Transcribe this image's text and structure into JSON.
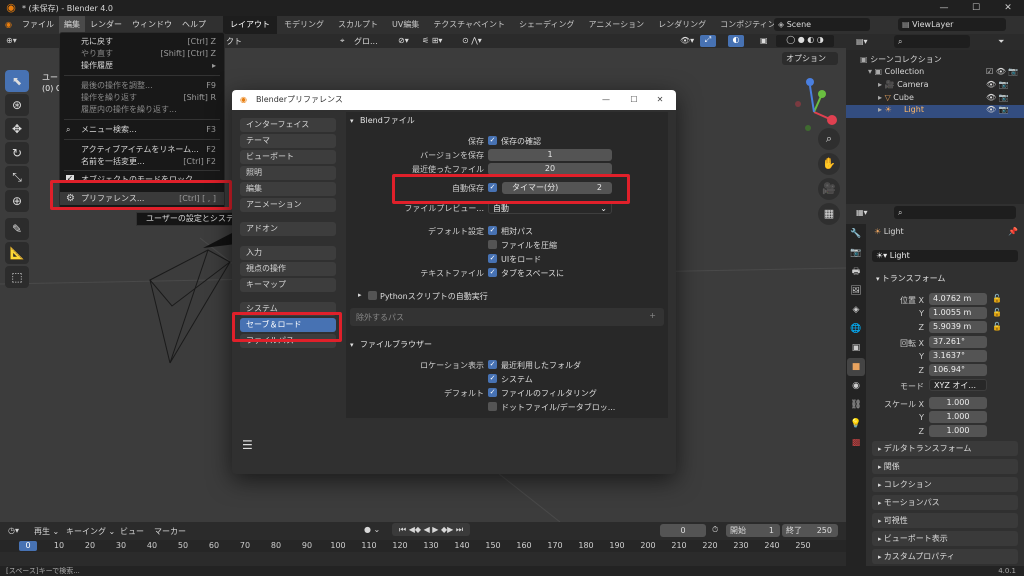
{
  "window": {
    "title": "* (未保存) - Blender 4.0",
    "controls": [
      "—",
      "☐",
      "✕"
    ]
  },
  "menubar": {
    "items": [
      "ファイル",
      "編集",
      "レンダー",
      "ウィンドウ",
      "ヘルプ"
    ],
    "workspaces": [
      "レイアウト",
      "モデリング",
      "スカルプト",
      "UV編集",
      "テクスチャペイント",
      "シェーディング",
      "アニメーション",
      "レンダリング",
      "コンポジティング"
    ],
    "scene": "Scene",
    "view_layer": "ViewLayer"
  },
  "viewport_header": {
    "mode_partial": "クト",
    "transform_orientation": "グロ...",
    "options": "オプション"
  },
  "viewport_text": {
    "line1": "ユー",
    "line2": "(0) C"
  },
  "edit_menu": {
    "items": [
      {
        "label": "元に戻す",
        "shortcut": "[Ctrl] Z",
        "dim": false
      },
      {
        "label": "やり直す",
        "shortcut": "[Shift] [Ctrl] Z",
        "dim": true
      },
      {
        "label": "操作履歴",
        "shortcut": "▸",
        "dim": false
      },
      {
        "label": "最後の操作を調整...",
        "shortcut": "F9",
        "dim": true
      },
      {
        "label": "操作を繰り返す",
        "shortcut": "[Shift] R",
        "dim": true
      },
      {
        "label": "履歴内の操作を繰り返す...",
        "shortcut": "",
        "dim": true
      },
      {
        "label": "メニュー検索...",
        "shortcut": "F3",
        "dim": false
      },
      {
        "label": "アクティブアイテムをリネーム...",
        "shortcut": "F2",
        "dim": false
      },
      {
        "label": "名前を一括変更...",
        "shortcut": "[Ctrl] F2",
        "dim": false
      },
      {
        "label": "オブジェクトのモードをロック",
        "shortcut": "",
        "dim": false
      },
      {
        "label": "プリファレンス...",
        "shortcut": "[Ctrl] [ , ]",
        "dim": false
      }
    ],
    "tooltip": "ユーザーの設定とシステム"
  },
  "prefs": {
    "title": "Blenderプリファレンス",
    "categories": [
      "インターフェイス",
      "テーマ",
      "ビューポート",
      "照明",
      "編集",
      "アニメーション",
      "アドオン",
      "入力",
      "視点の操作",
      "キーマップ",
      "システム",
      "セーブ＆ロード",
      "ファイルパス"
    ],
    "selected_category": "セーブ＆ロード",
    "blend_section": "Blendファイル",
    "save_label": "保存",
    "save_confirm": "保存の確認",
    "save_versions_label": "バージョンを保存",
    "save_versions_value": "1",
    "recent_files_label": "最近使ったファイル",
    "recent_files_value": "20",
    "autosave_label": "自動保存",
    "timer_label": "タイマー(分)",
    "timer_value": "2",
    "file_preview_label": "ファイルプレビュー...",
    "file_preview_value": "自動",
    "default_label": "デフォルト設定",
    "relative_paths": "相対パス",
    "compress": "ファイルを圧縮",
    "load_ui": "UIをロード",
    "text_files_label": "テキストファイル",
    "tabs_as_spaces": "タブをスペースに",
    "python_autoexec": "Pythonスクリプトの自動実行",
    "excluded_paths": "除外するパス",
    "file_browser_section": "ファイルブラウザー",
    "location_label": "ロケーション表示",
    "recent_folders": "最近利用したフォルダ",
    "system": "システム",
    "defaults_label": "デフォルト",
    "filter_files": "ファイルのフィルタリング",
    "dot_files": "ドットファイル/データブロッ...",
    "menu_icon": "☰"
  },
  "outliner": {
    "title": "シーンコレクション",
    "items": [
      {
        "label": "Collection",
        "indent": 1
      },
      {
        "label": "Camera",
        "indent": 2
      },
      {
        "label": "Cube",
        "indent": 2
      },
      {
        "label": "Light",
        "indent": 2
      }
    ]
  },
  "properties": {
    "object_name": "Light",
    "data_name": "Light",
    "transform": "トランスフォーム",
    "location_label": "位置 X",
    "loc": [
      "4.0762 m",
      "1.0055 m",
      "5.9039 m"
    ],
    "rotation_label": "回転 X",
    "rot": [
      "37.261°",
      "3.1637°",
      "106.94°"
    ],
    "mode_label": "モード",
    "mode_value": "XYZ オイ...",
    "scale_label": "スケール X",
    "scale": [
      "1.000",
      "1.000",
      "1.000"
    ],
    "axis_y": "Y",
    "axis_z": "Z",
    "subpanels": [
      "デルタトランスフォーム",
      "関係",
      "コレクション",
      "モーションパス",
      "可視性",
      "ビューポート表示",
      "カスタムプロパティ"
    ]
  },
  "timeline": {
    "menus": [
      "再生",
      "キーイング",
      "ビュー",
      "マーカー"
    ],
    "current_frame": "0",
    "start_label": "開始",
    "start_value": "1",
    "end_label": "終了",
    "end_value": "250",
    "ticks": [
      "0",
      "10",
      "20",
      "30",
      "40",
      "50",
      "60",
      "70",
      "80",
      "90",
      "100",
      "110",
      "120",
      "130",
      "140",
      "150",
      "160",
      "170",
      "180",
      "190",
      "200",
      "210",
      "220",
      "230",
      "240",
      "250"
    ]
  },
  "statusbar": {
    "hint": "[スペース]キーで検索...",
    "version": "4.0.1"
  },
  "colors": {
    "accent": "#4772b3",
    "highlight_red": "#e0202a",
    "blender_orange": "#e87d0d"
  }
}
